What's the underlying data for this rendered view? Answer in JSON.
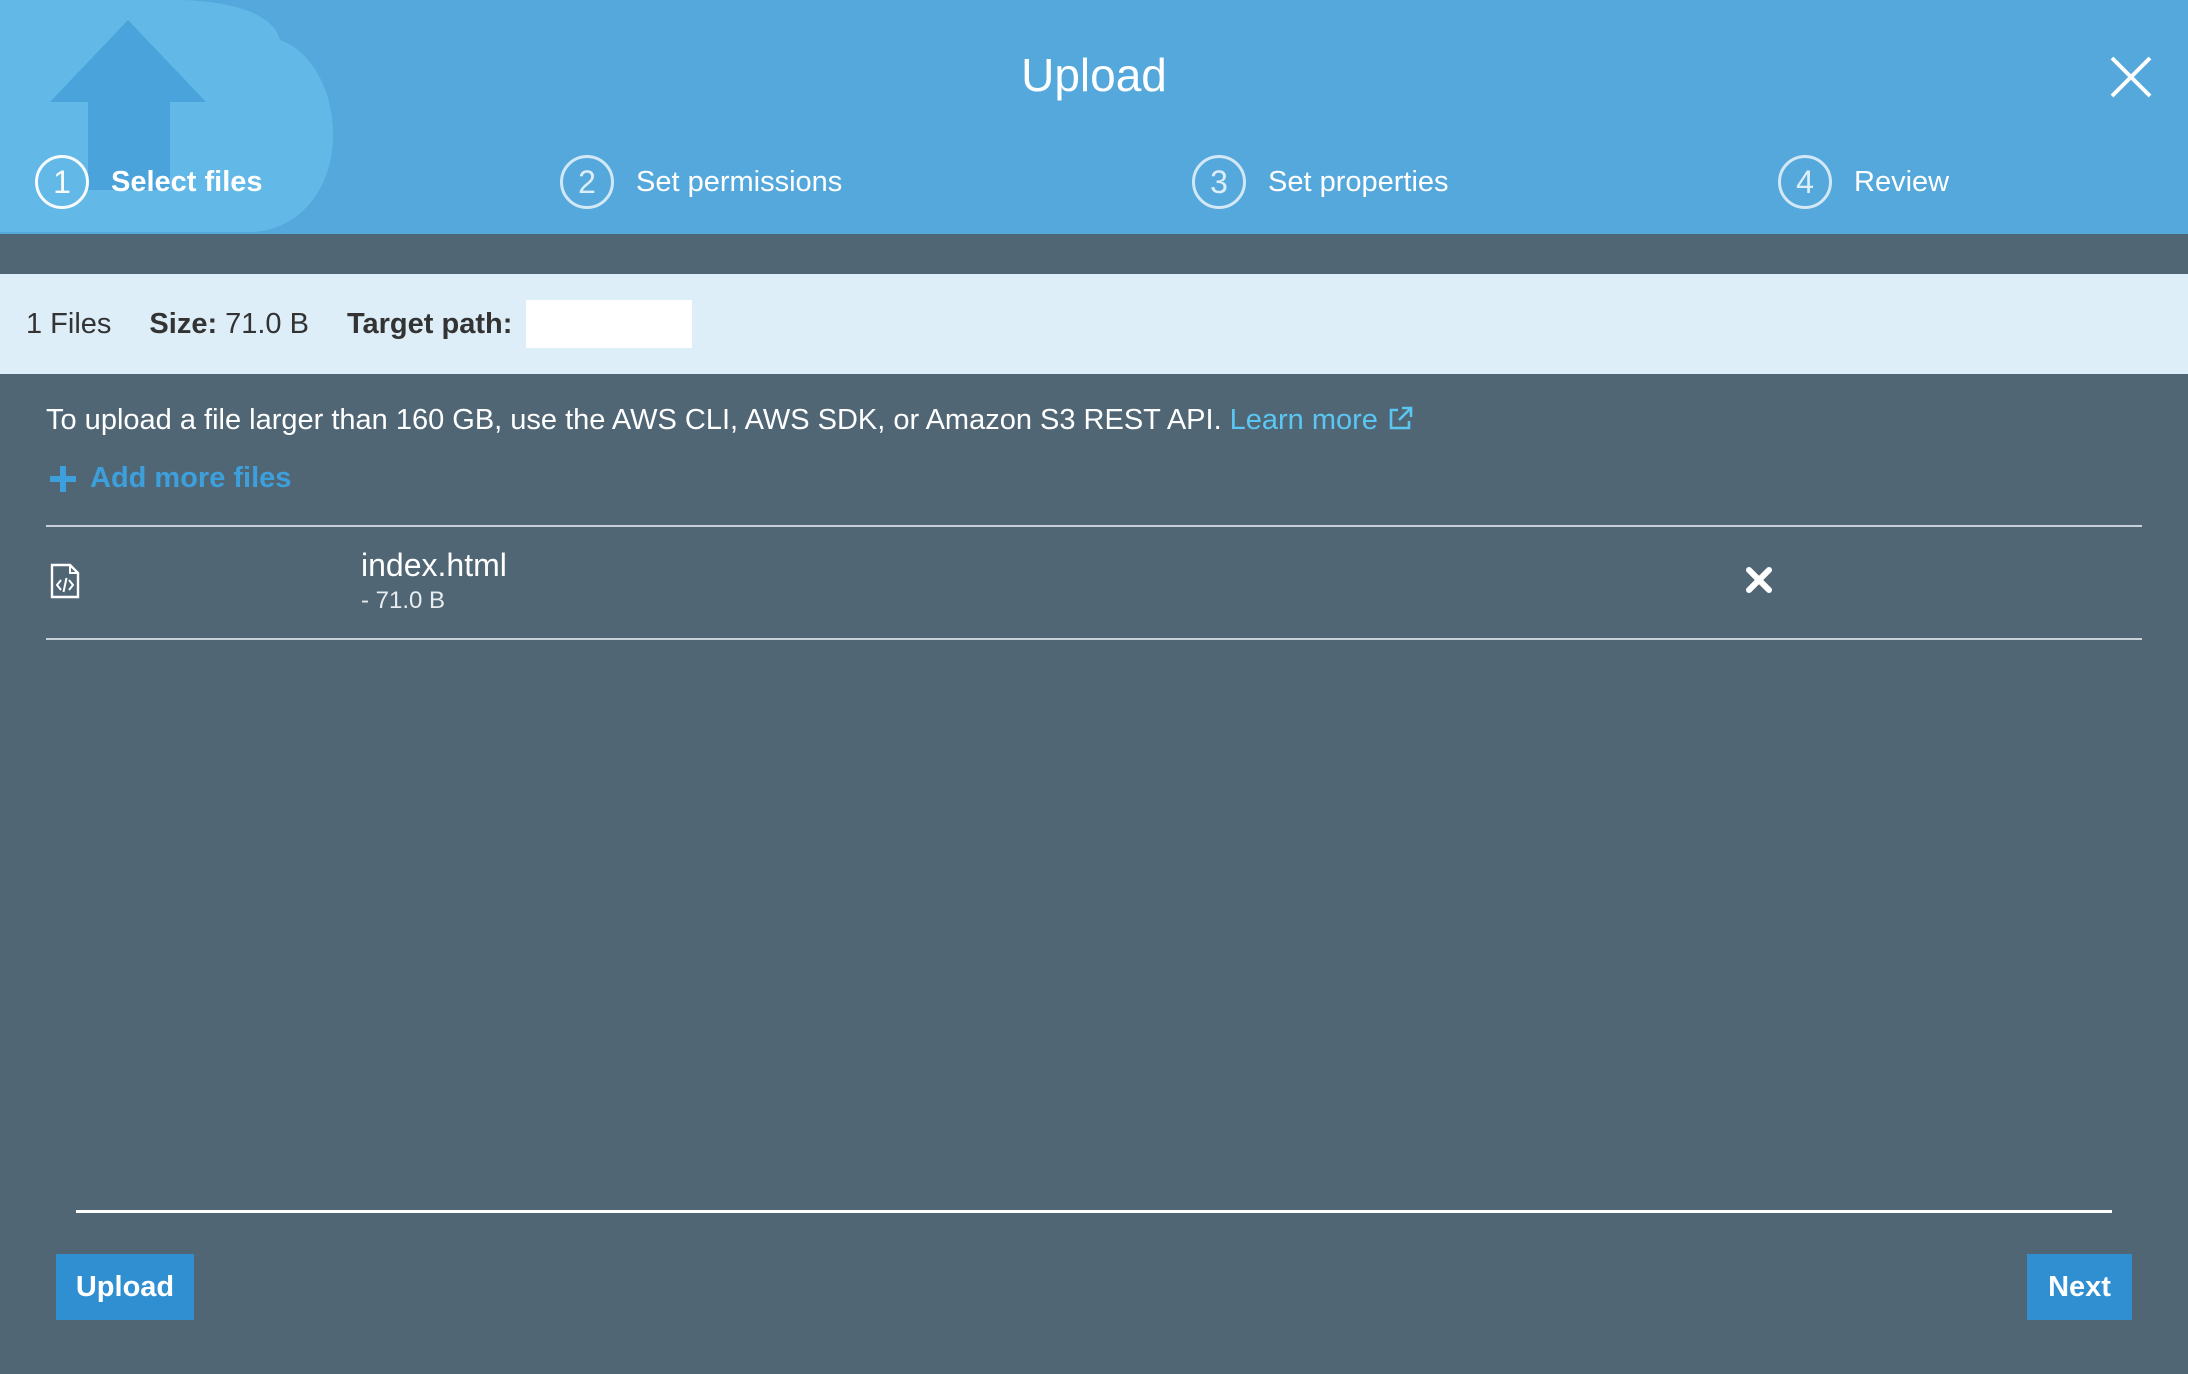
{
  "header": {
    "title": "Upload",
    "close_icon": "close-icon",
    "steps": [
      {
        "number": "1",
        "label": "Select files",
        "active": true
      },
      {
        "number": "2",
        "label": "Set permissions",
        "active": false
      },
      {
        "number": "3",
        "label": "Set properties",
        "active": false
      },
      {
        "number": "4",
        "label": "Review",
        "active": false
      }
    ]
  },
  "summary": {
    "files_count": "1 Files",
    "size_label": "Size:",
    "size_value": "71.0 B",
    "target_label": "Target path:",
    "target_value": ""
  },
  "body": {
    "info_text": "To upload a file larger than 160 GB, use the AWS CLI, AWS SDK, or Amazon S3 REST API.",
    "learn_more": "Learn more",
    "add_more_files": "Add more files",
    "files": [
      {
        "name": "index.html",
        "size": "- 71.0 B",
        "icon": "html-file-icon"
      }
    ]
  },
  "footer": {
    "upload_label": "Upload",
    "next_label": "Next"
  },
  "colors": {
    "header_bg": "#54a8dc",
    "body_bg": "#506675",
    "summary_bg": "#ddeef9",
    "link": "#5bc6f2",
    "button_bg": "#2f8fd1"
  }
}
